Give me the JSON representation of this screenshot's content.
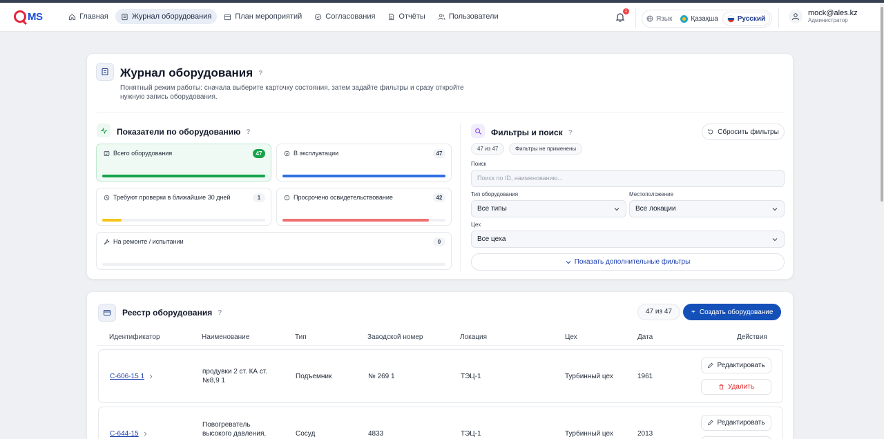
{
  "brand": {
    "logo_text": "MS"
  },
  "nav": [
    {
      "label": "Главная"
    },
    {
      "label": "Журнал оборудования",
      "active": true
    },
    {
      "label": "План мероприятий"
    },
    {
      "label": "Согласования"
    },
    {
      "label": "Отчёты"
    },
    {
      "label": "Пользователи"
    }
  ],
  "notifications": {
    "count": "1"
  },
  "language": {
    "label": "Язык",
    "options": [
      "Қазақша",
      "Русский"
    ],
    "selected": "Русский"
  },
  "user": {
    "email": "mock@ales.kz",
    "role": "Администратор"
  },
  "page": {
    "title": "Журнал оборудования",
    "help": "?",
    "description": "Понятный режим работы: сначала выберите карточку состояния, затем задайте фильтры и сразу откройте нужную запись оборудования."
  },
  "stats": {
    "title": "Показатели по оборудованию",
    "items": [
      {
        "label": "Всего оборудования",
        "count": "47",
        "fill": 1.0,
        "color": "#16a34a"
      },
      {
        "label": "В эксплуатации",
        "count": "47",
        "fill": 1.0,
        "color": "#2f6fe0"
      },
      {
        "label": "Требуют проверки в ближайшие 30 дней",
        "count": "1",
        "fill": 0.12,
        "color": "#f5c518"
      },
      {
        "label": "Просрочено освидетельствование",
        "count": "42",
        "fill": 0.9,
        "color": "#f07070"
      },
      {
        "label": "На ремонте / испытании",
        "count": "0",
        "fill": 0.0,
        "color": "#9ca3af"
      }
    ]
  },
  "filters": {
    "title": "Фильтры и поиск",
    "reset_label": "Сбросить фильтры",
    "summary_count": "47 из 47",
    "summary_state": "Фильтры не применены",
    "search_label": "Поиск",
    "search_placeholder": "Поиск по ID, наименованию...",
    "type_label": "Тип оборудования",
    "type_value": "Все типы",
    "location_label": "Местоположение",
    "location_value": "Все локации",
    "shop_label": "Цех",
    "shop_value": "Все цеха",
    "more_label": "Показать дополнительные фильтры"
  },
  "registry": {
    "title": "Реестр оборудования",
    "count": "47 из 47",
    "create_label": "Создать оборудование",
    "columns": [
      "Идентификатор",
      "Наименование",
      "Тип",
      "Заводской номер",
      "Локация",
      "Цех",
      "Дата",
      "Действия"
    ],
    "rows": [
      {
        "id": "С-606-15 1",
        "name": "продувки 2 ст. КА ст. №8,9 1",
        "type": "Подъемник",
        "serial": "№ 269 1",
        "location": "ТЭЦ-1",
        "shop": "Турбинный цех",
        "date": "1961"
      },
      {
        "id": "С-644-15",
        "name": "Повогреватель высокого давления,",
        "type": "Сосуд",
        "serial": "4833",
        "location": "ТЭЦ-1",
        "shop": "Турбинный цех",
        "date": "2013"
      }
    ],
    "edit_label": "Редактировать",
    "delete_label": "Удалить"
  }
}
